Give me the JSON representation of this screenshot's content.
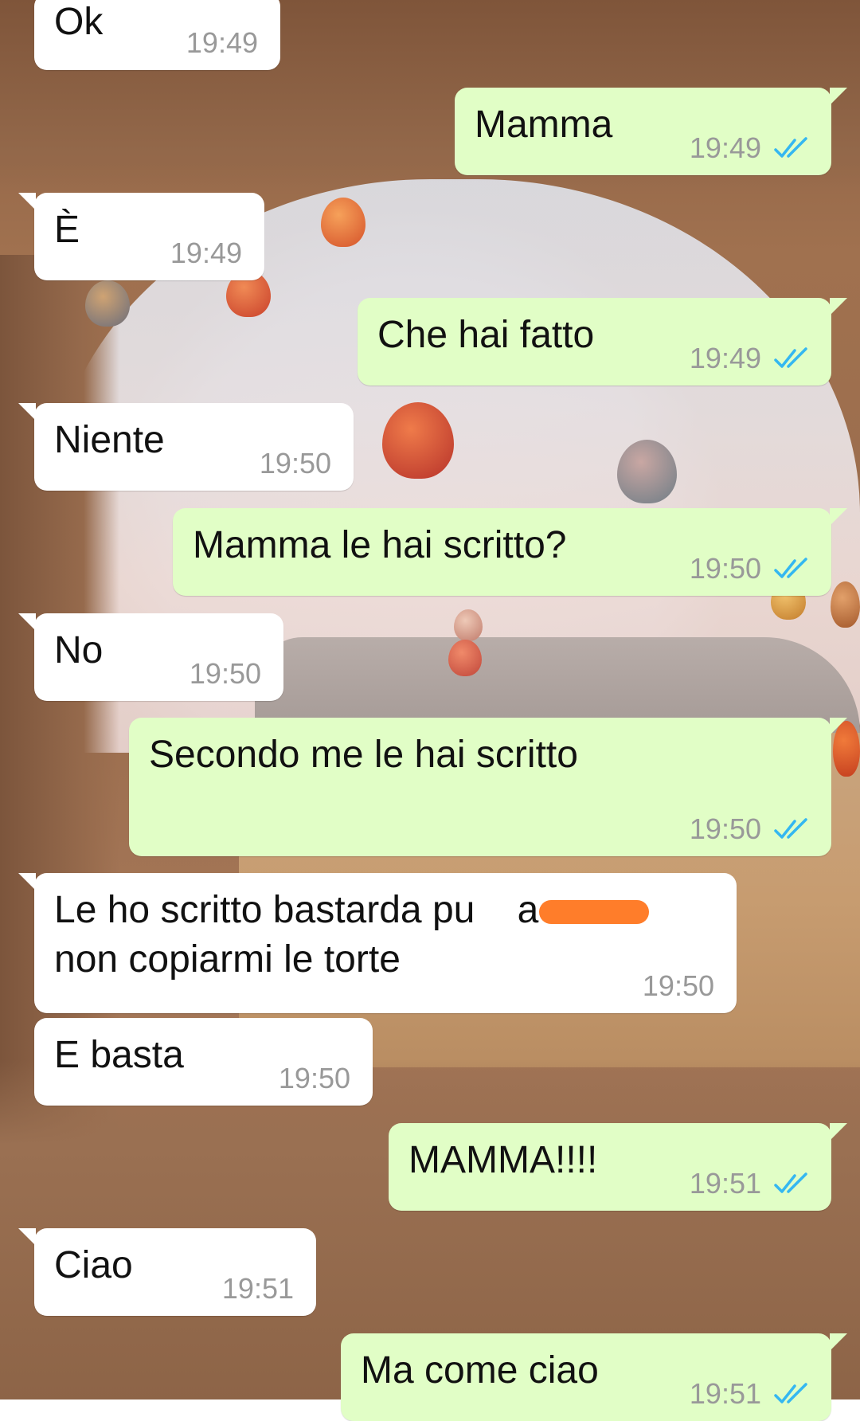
{
  "colors": {
    "incoming_bubble": "#ffffff",
    "outgoing_bubble": "#e1fec6",
    "timestamp": "#999999",
    "read_ticks": "#34b7f1",
    "redaction": "#ff7d2a"
  },
  "messages": [
    {
      "direction": "in",
      "text": "Ok",
      "time": "19:49"
    },
    {
      "direction": "out",
      "text": "Mamma",
      "time": "19:49",
      "status": "read-double-check-icon"
    },
    {
      "direction": "in",
      "text": "È",
      "time": "19:49"
    },
    {
      "direction": "out",
      "text": "Che hai fatto",
      "time": "19:49",
      "status": "read-double-check-icon"
    },
    {
      "direction": "in",
      "text": "Niente",
      "time": "19:50"
    },
    {
      "direction": "out",
      "text": "Mamma le hai scritto?",
      "time": "19:50",
      "status": "read-double-check-icon"
    },
    {
      "direction": "in",
      "text": "No",
      "time": "19:50"
    },
    {
      "direction": "out",
      "text": "Secondo me le hai scritto",
      "time": "19:50",
      "status": "read-double-check-icon"
    },
    {
      "direction": "in",
      "text": "Le ho scritto bastarda pu    a\nnon copiarmi le torte",
      "time": "19:50"
    },
    {
      "direction": "in",
      "text": "E basta",
      "time": "19:50"
    },
    {
      "direction": "out",
      "text": "MAMMA!!!!",
      "time": "19:51",
      "status": "read-double-check-icon"
    },
    {
      "direction": "in",
      "text": "Ciao",
      "time": "19:51"
    },
    {
      "direction": "out",
      "text": "Ma come ciao",
      "time": "19:51",
      "status": "read-double-check-icon"
    }
  ]
}
